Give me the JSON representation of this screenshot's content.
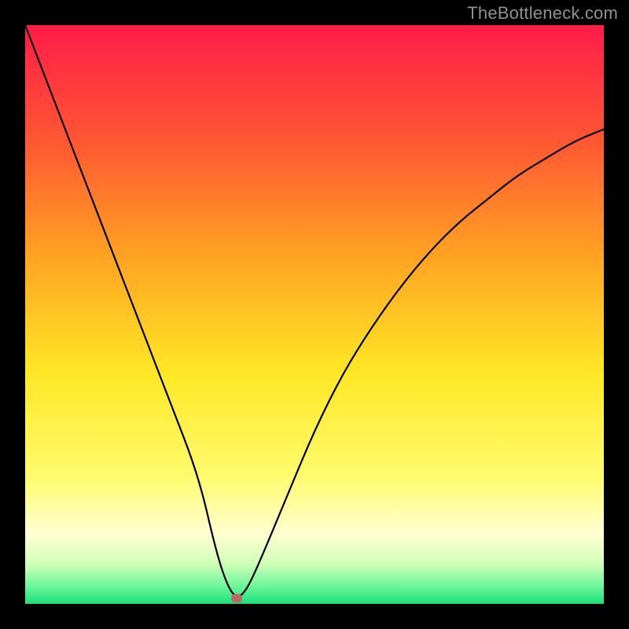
{
  "watermark": "TheBottleneck.com",
  "chart_data": {
    "type": "line",
    "title": "",
    "xlabel": "",
    "ylabel": "",
    "xlim": [
      0,
      100
    ],
    "ylim": [
      0,
      100
    ],
    "grid": false,
    "legend": false,
    "series": [
      {
        "name": "bottleneck-curve",
        "x": [
          0,
          5,
          10,
          15,
          20,
          25,
          30,
          33,
          35,
          36.5,
          38,
          40,
          45,
          50,
          55,
          60,
          65,
          70,
          75,
          80,
          85,
          90,
          95,
          100
        ],
        "values": [
          100,
          87,
          74,
          61,
          48,
          35,
          22,
          9,
          3,
          1,
          2,
          6,
          18,
          30,
          40,
          48,
          55,
          61,
          66,
          70,
          74,
          77,
          80,
          82
        ]
      }
    ],
    "marker": {
      "x": 36.5,
      "y": 1,
      "color": "#bb6a5f"
    },
    "gradient_stops": [
      {
        "offset": 0.0,
        "color": "#ff1c49"
      },
      {
        "offset": 0.2,
        "color": "#ff5733"
      },
      {
        "offset": 0.4,
        "color": "#ffa322"
      },
      {
        "offset": 0.6,
        "color": "#fee725"
      },
      {
        "offset": 0.78,
        "color": "#fffb6d"
      },
      {
        "offset": 0.88,
        "color": "#ffffd2"
      },
      {
        "offset": 0.93,
        "color": "#d2ffb8"
      },
      {
        "offset": 0.97,
        "color": "#6cf59a"
      },
      {
        "offset": 1.0,
        "color": "#19e07a"
      }
    ]
  }
}
